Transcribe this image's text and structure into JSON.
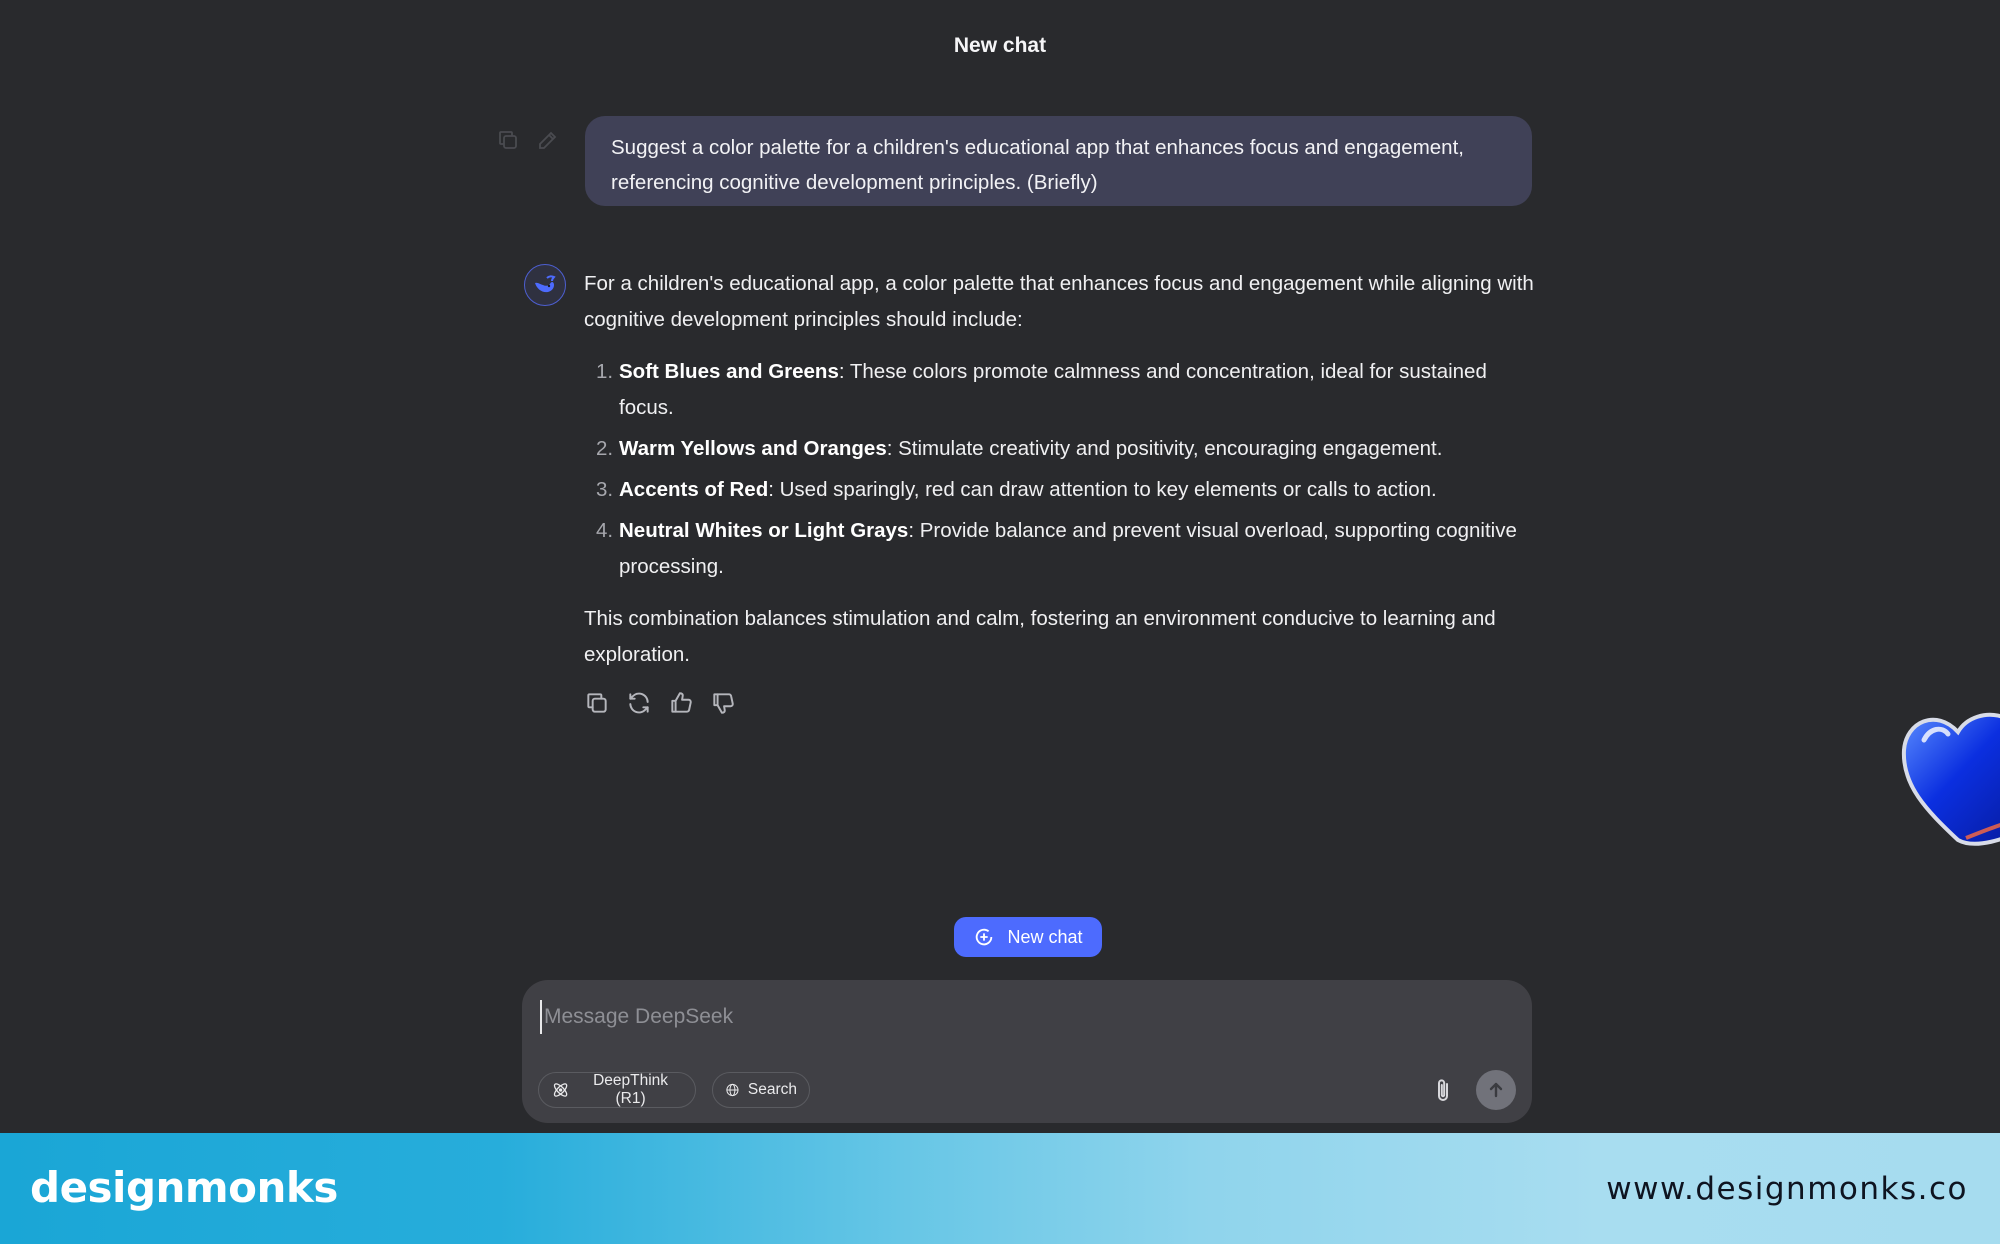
{
  "header": {
    "title": "New chat"
  },
  "user_message": {
    "text": "Suggest a color palette for a children's educational app that enhances focus and engagement, referencing cognitive development principles. (Briefly)"
  },
  "assistant": {
    "intro": "For a children's educational app, a color palette that enhances focus and engagement while aligning with cognitive development principles should include:",
    "items": [
      {
        "num": "1.",
        "title": "Soft Blues and Greens",
        "text": ": These colors promote calmness and concentration, ideal for sustained focus."
      },
      {
        "num": "2.",
        "title": "Warm Yellows and Oranges",
        "text": ": Stimulate creativity and positivity, encouraging engagement."
      },
      {
        "num": "3.",
        "title": "Accents of Red",
        "text": ": Used sparingly, red can draw attention to key elements or calls to action."
      },
      {
        "num": "4.",
        "title": "Neutral Whites or Light Grays",
        "text": ": Provide balance and prevent visual overload, supporting cognitive processing."
      }
    ],
    "conclusion": "This combination balances stimulation and calm, fostering an environment conducive to learning and exploration."
  },
  "new_chat_button": {
    "label": "New chat"
  },
  "composer": {
    "placeholder": "Message DeepSeek",
    "value": "",
    "deepthink_label": "DeepThink (R1)",
    "search_label": "Search"
  },
  "footer": {
    "brand": "designmonks",
    "website": "www.designmonks.co"
  },
  "colors": {
    "background": "#292a2d",
    "user_bubble": "#404157",
    "accent": "#4d6bfe",
    "composer": "#404045"
  }
}
